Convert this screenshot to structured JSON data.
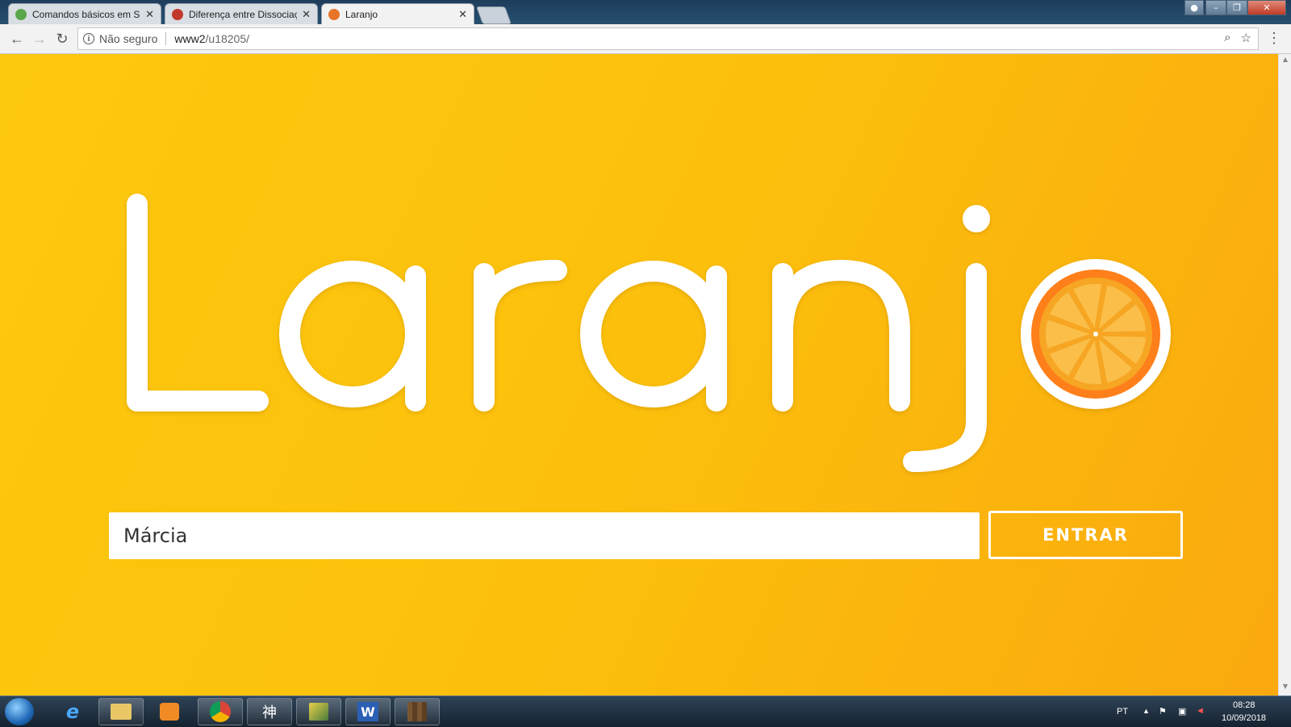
{
  "browser": {
    "tabs": [
      {
        "label": "Comandos básicos em SQ",
        "favicon_color": "#5aa64a",
        "active": false
      },
      {
        "label": "Diferença entre Dissociaç",
        "favicon_color": "#c0392b",
        "active": false
      },
      {
        "label": "Laranjo",
        "favicon_color": "#e8742a",
        "active": true
      }
    ],
    "close_glyph": "✕",
    "security_label": "Não seguro",
    "url_host": "www2",
    "url_path": "/u18205/",
    "zoom_icon": "magnifier-icon",
    "bookmark_icon": "star-icon"
  },
  "page": {
    "logo_text": "Laranj",
    "logo_colors": {
      "text": "#ffffff",
      "orange_rind": "#ff7f1a",
      "orange_pulp": "#f6a623",
      "segment": "#fbbf49"
    },
    "name_input_value": "Márcia",
    "enter_label": "ENTRAR",
    "background_start": "#fdc90e",
    "background_end": "#faa90e"
  },
  "taskbar": {
    "items": [
      "internet-explorer",
      "file-explorer",
      "media-player",
      "chrome",
      "ime-tool",
      "build-tool",
      "word",
      "minecraft"
    ],
    "ime_glyph": "神",
    "word_glyph": "W",
    "language": "PT",
    "time": "08:28",
    "date": "10/09/2018"
  }
}
